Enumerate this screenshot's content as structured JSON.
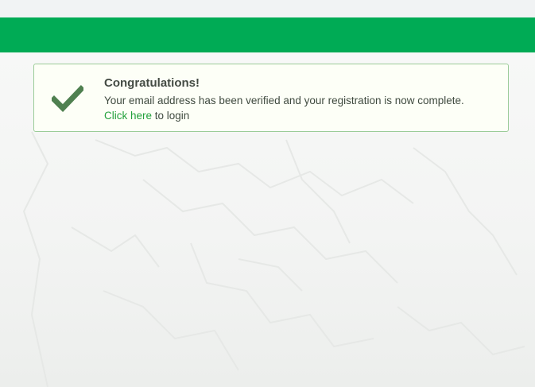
{
  "colors": {
    "header_bar": "#00ab55",
    "alert_border": "#9bcc98",
    "alert_background": "#fdfff7",
    "check_icon": "#4f8050",
    "link": "#22a03c"
  },
  "alert": {
    "icon": "checkmark-icon",
    "title": "Congratulations!",
    "message": "Your email address has been verified and your registration is now complete.",
    "link_text": "Click here",
    "link_suffix": " to login"
  }
}
